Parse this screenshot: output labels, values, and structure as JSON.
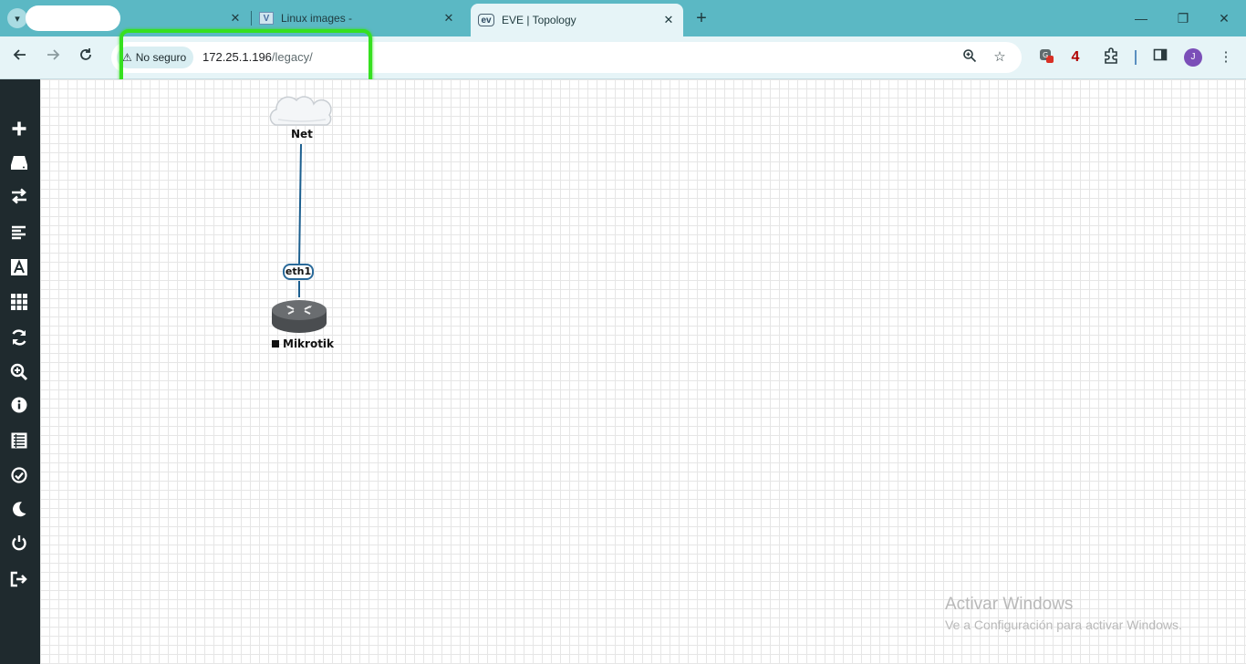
{
  "browser": {
    "tabs": [
      {
        "title": "",
        "redacted": true
      },
      {
        "title": "Linux images -"
      },
      {
        "title": "EVE | Topology",
        "active": true
      }
    ],
    "newtab_label": "+",
    "window_controls": {
      "minimize": "—",
      "restore": "❐",
      "close": "✕"
    },
    "address": {
      "security_label": "No seguro",
      "host": "172.25.1.196",
      "path": "/legacy/"
    },
    "extension_badge": "4",
    "avatar_initial": "J",
    "highlight_color": "#36e020"
  },
  "sidebar": {
    "items": [
      {
        "name": "add-object",
        "icon": "plus-icon"
      },
      {
        "name": "nodes",
        "icon": "server-icon"
      },
      {
        "name": "networks",
        "icon": "exchange-icon"
      },
      {
        "name": "startup-configs",
        "icon": "align-left-icon"
      },
      {
        "name": "text",
        "icon": "font-icon"
      },
      {
        "name": "pictures",
        "icon": "grid-icon"
      },
      {
        "name": "refresh",
        "icon": "refresh-icon"
      },
      {
        "name": "zoom",
        "icon": "zoom-icon"
      },
      {
        "name": "lab-details",
        "icon": "info-icon"
      },
      {
        "name": "lab-list",
        "icon": "list-icon"
      },
      {
        "name": "status",
        "icon": "check-circle-icon"
      },
      {
        "name": "theme",
        "icon": "moon-icon"
      },
      {
        "name": "power",
        "icon": "power-icon"
      },
      {
        "name": "logout",
        "icon": "logout-icon"
      }
    ]
  },
  "topology": {
    "cloud_label": "Net",
    "router_label": "Mikrotik",
    "interface_label": "eth1",
    "link_color": "#1c5f8f"
  },
  "watermark": {
    "title": "Activar Windows",
    "subtitle": "Ve a Configuración para activar Windows."
  }
}
